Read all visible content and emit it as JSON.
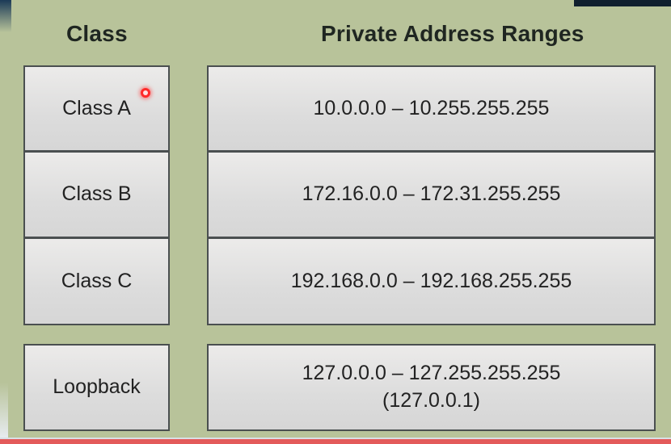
{
  "table": {
    "headers": {
      "class": "Class",
      "ranges": "Private Address Ranges"
    },
    "rows": [
      {
        "class": "Class A",
        "range": "10.0.0.0 – 10.255.255.255"
      },
      {
        "class": "Class B",
        "range": "172.16.0.0 – 172.31.255.255"
      },
      {
        "class": "Class C",
        "range": "192.168.0.0 – 192.168.255.255"
      }
    ],
    "loopback": {
      "class": "Loopback",
      "range": "127.0.0.0 – 127.255.255.255",
      "address": "(127.0.0.1)"
    }
  },
  "colors": {
    "slide_background": "#b8c39a",
    "cell_fill": "#dcdcdc",
    "cell_border": "#4a4f50",
    "pointer": "#ff2a2a",
    "progress_bar": "#e35a5a"
  }
}
